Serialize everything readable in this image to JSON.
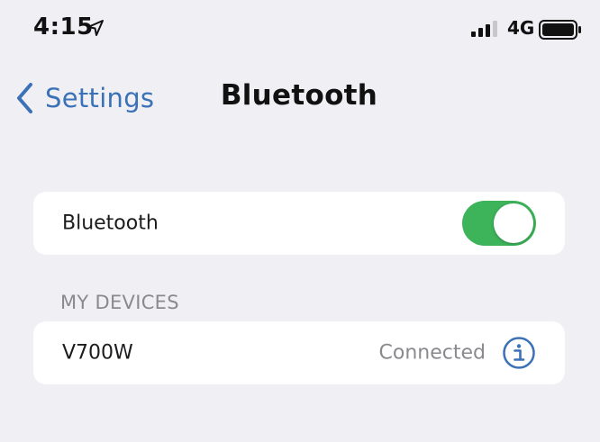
{
  "status_bar": {
    "time": "4:15",
    "network": "4G",
    "icons": [
      "location-arrow-icon",
      "cellular-signal-icon",
      "battery-icon"
    ]
  },
  "nav": {
    "back_label": "Settings",
    "title": "Bluetooth"
  },
  "bluetooth_row": {
    "label": "Bluetooth",
    "toggle_on": true
  },
  "my_devices": {
    "header": "MY DEVICES",
    "items": [
      {
        "name": "V700W",
        "status": "Connected",
        "icon": "info-icon"
      }
    ]
  },
  "colors": {
    "background": "#efeff4",
    "accent_blue": "#3b71b7",
    "toggle_green": "#3db35a",
    "secondary_text": "#8a8a8e"
  }
}
